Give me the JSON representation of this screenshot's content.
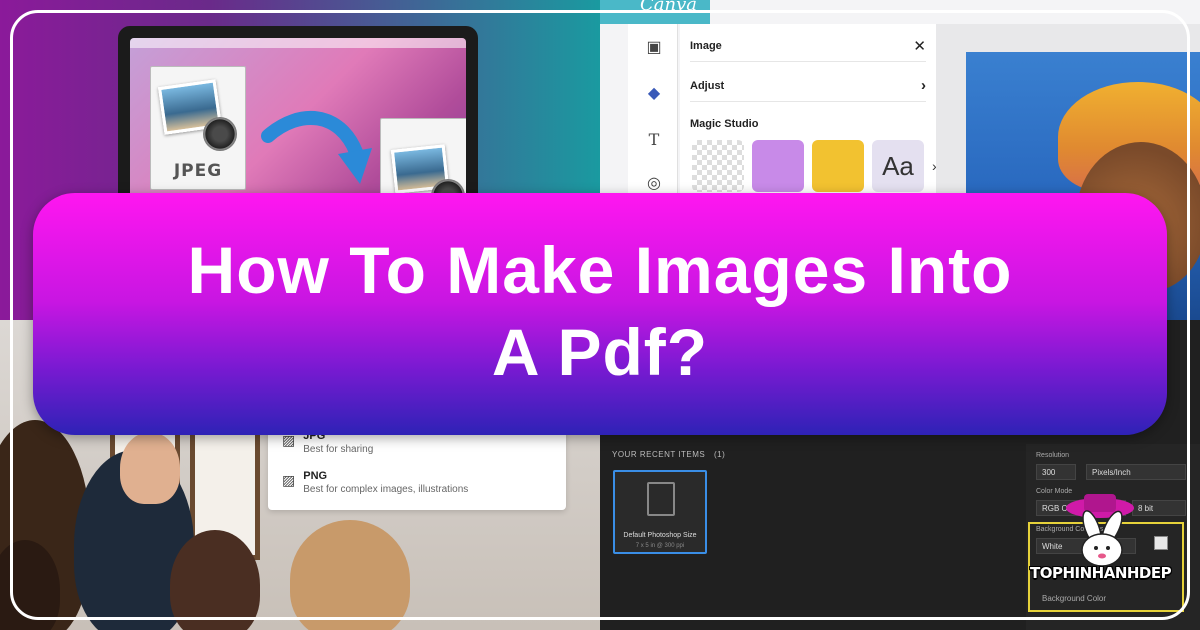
{
  "headline": {
    "line1": "How To Make Images Into",
    "line2": "A Pdf?"
  },
  "colors": {
    "banner_top": "#ff16f0",
    "banner_bottom": "#2e22b6",
    "frame": "#ffffff",
    "text": "#ffffff"
  },
  "laptop_scene": {
    "file_label": "JPEG",
    "convert_arrow_icon": "curved-arrow-icon"
  },
  "canva": {
    "logo": "Canva",
    "panel": {
      "image_label": "Image",
      "adjust_label": "Adjust",
      "magic_studio_label": "Magic Studio",
      "thumb_text": "Aa"
    }
  },
  "export_menu": {
    "items": [
      {
        "title": "JPG",
        "desc": "Best for sharing",
        "icon": "image-icon"
      },
      {
        "title": "PNG",
        "desc": "Best for complex images, illustrations",
        "icon": "image-icon"
      }
    ]
  },
  "photoshop": {
    "recent_label": "YOUR RECENT ITEMS",
    "recent_count": "(1)",
    "card_title": "Default Photoshop Size",
    "card_sub": "7 x 5 in @ 300 ppi",
    "resolution_label": "Resolution",
    "resolution_value": "300",
    "resolution_unit": "Pixels/Inch",
    "color_mode_label": "Color Mode",
    "color_mode_value": "RGB Color",
    "bit_depth": "8 bit",
    "bg_contents_label": "Background Contents",
    "bg_value": "White",
    "bg_color_label": "Background Color"
  },
  "brand": {
    "name": "TOPHINHANHDEP"
  }
}
